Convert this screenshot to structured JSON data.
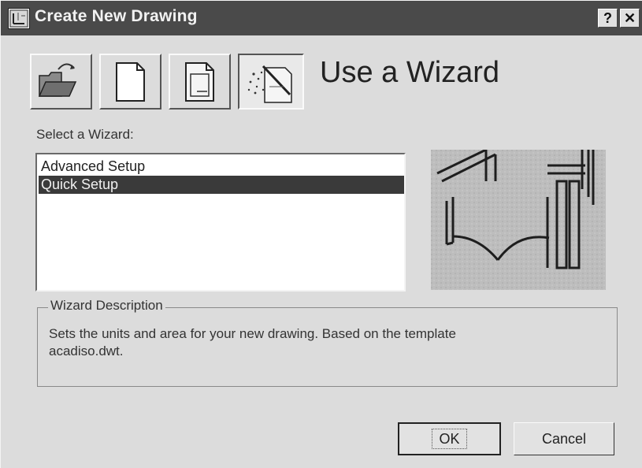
{
  "window": {
    "title": "Create New Drawing",
    "help_label": "?",
    "close_label": "✕"
  },
  "mode_buttons": [
    {
      "name": "Open a Drawing",
      "icon": "open-folder-icon"
    },
    {
      "name": "Start from Scratch",
      "icon": "blank-page-icon"
    },
    {
      "name": "Use a Template",
      "icon": "template-page-icon"
    },
    {
      "name": "Use a Wizard",
      "icon": "wizard-wand-icon"
    }
  ],
  "mode_heading": "Use a Wizard",
  "wizard_select_label": "Select a Wizard:",
  "wizards": [
    {
      "label": "Advanced Setup",
      "selected": false
    },
    {
      "label": "Quick Setup",
      "selected": true
    }
  ],
  "description": {
    "legend": "Wizard Description",
    "text": "Sets the units and area for your new drawing. Based on the template\nacadiso.dwt."
  },
  "buttons": {
    "ok": "OK",
    "cancel": "Cancel"
  },
  "colors": {
    "titlebar": "#4a4a4a",
    "selection": "#3a3a3a",
    "face": "#dcdcdc"
  }
}
